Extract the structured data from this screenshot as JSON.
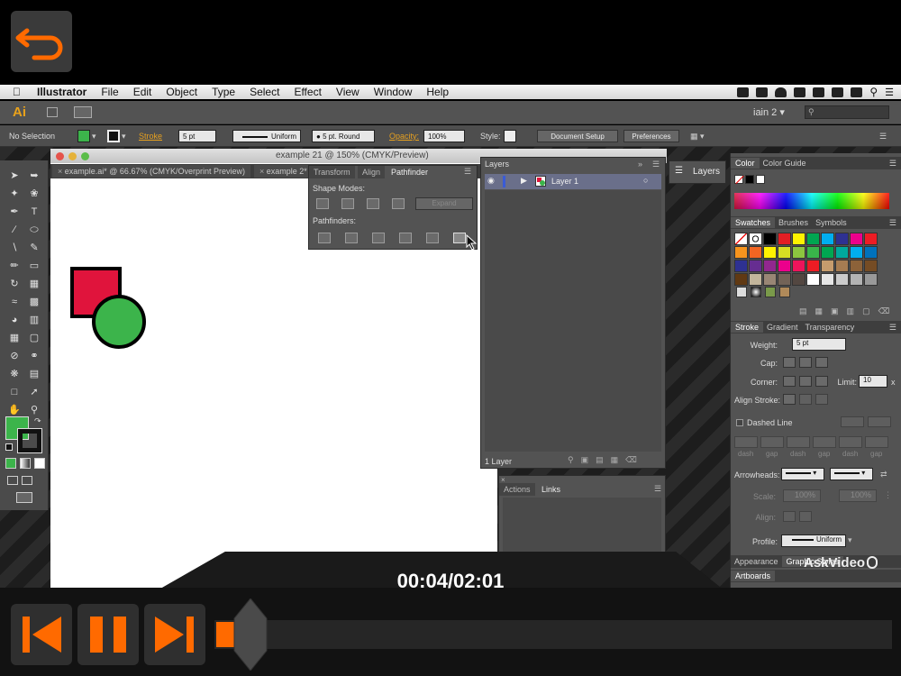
{
  "menubar": {
    "app": "Illustrator",
    "items": [
      "File",
      "Edit",
      "Object",
      "Type",
      "Select",
      "Effect",
      "View",
      "Window",
      "Help"
    ]
  },
  "appbar": {
    "logo": "Ai",
    "workspace": "iain 2"
  },
  "controlbar": {
    "selection": "No Selection",
    "stroke_label": "Stroke",
    "stroke_weight": "5 pt",
    "stroke_style": "Uniform",
    "brush": "5 pt. Round",
    "opacity_label": "Opacity:",
    "opacity_value": "100%",
    "style_label": "Style:",
    "document_setup": "Document Setup",
    "preferences": "Preferences"
  },
  "document": {
    "window_title": "example 21 @ 150% (CMYK/Preview)",
    "tabs": [
      "example.ai* @ 66.67% (CMYK/Overprint Preview)",
      "example 2*"
    ]
  },
  "pathfinder": {
    "tabs": [
      "Transform",
      "Align",
      "Pathfinder"
    ],
    "active_tab": "Pathfinder",
    "shape_modes_label": "Shape Modes:",
    "expand": "Expand",
    "pathfinders_label": "Pathfinders:"
  },
  "layers": {
    "title": "Layers",
    "layer_name": "Layer 1",
    "footer": "1 Layer",
    "collapsed_label": "Layers"
  },
  "actions": {
    "tabs": [
      "Actions",
      "Links"
    ],
    "active_tab": "Links"
  },
  "right_dock": {
    "color_tabs": [
      "Color",
      "Color Guide"
    ],
    "swatch_tabs": [
      "Swatches",
      "Brushes",
      "Symbols"
    ],
    "stroke_tabs": [
      "Stroke",
      "Gradient",
      "Transparency"
    ],
    "weight_label": "Weight:",
    "weight_value": "5 pt",
    "cap_label": "Cap:",
    "corner_label": "Corner:",
    "limit_label": "Limit:",
    "limit_value": "10",
    "limit_unit": "x",
    "align_stroke_label": "Align Stroke:",
    "dashed_line_label": "Dashed Line",
    "dash_labels": [
      "dash",
      "gap",
      "dash",
      "gap",
      "dash",
      "gap"
    ],
    "arrowheads_label": "Arrowheads:",
    "scale_label": "Scale:",
    "scale_values": [
      "100%",
      "100%"
    ],
    "align_label": "Align:",
    "profile_label": "Profile:",
    "profile_value": "Uniform",
    "appearance_tabs": [
      "Appearance",
      "Graphic Styles"
    ],
    "artboards": "Artboards"
  },
  "player": {
    "time": "00:04/02:01",
    "progress": 0.033,
    "brand": "AskVideo"
  },
  "colors": {
    "accent": "#ff6a00",
    "red_square": "#e0143c",
    "green_circle": "#3cb44b",
    "fill_swatch": "#3cb44b"
  },
  "swatch_colors": [
    "#ffffff",
    "#ffffff",
    "#000000",
    "#e31e24",
    "#fff200",
    "#00a651",
    "#00aeef",
    "#2e3192",
    "#ec008c",
    "#ed1c24",
    "#f7941d",
    "#f26522",
    "#fff200",
    "#d7df23",
    "#8dc63f",
    "#39b54a",
    "#00a651",
    "#00a99d",
    "#00aeef",
    "#0072bc",
    "#2e3192",
    "#662d91",
    "#92278f",
    "#ec008c",
    "#ed145b",
    "#ed1c24",
    "#c69c6d",
    "#a67c52",
    "#8c6239",
    "#754c24",
    "#603913",
    "#c2b59b",
    "#998675",
    "#736357",
    "#534741",
    "#ffffff",
    "#e6e6e6",
    "#cccccc",
    "#b3b3b3",
    "#999999"
  ]
}
